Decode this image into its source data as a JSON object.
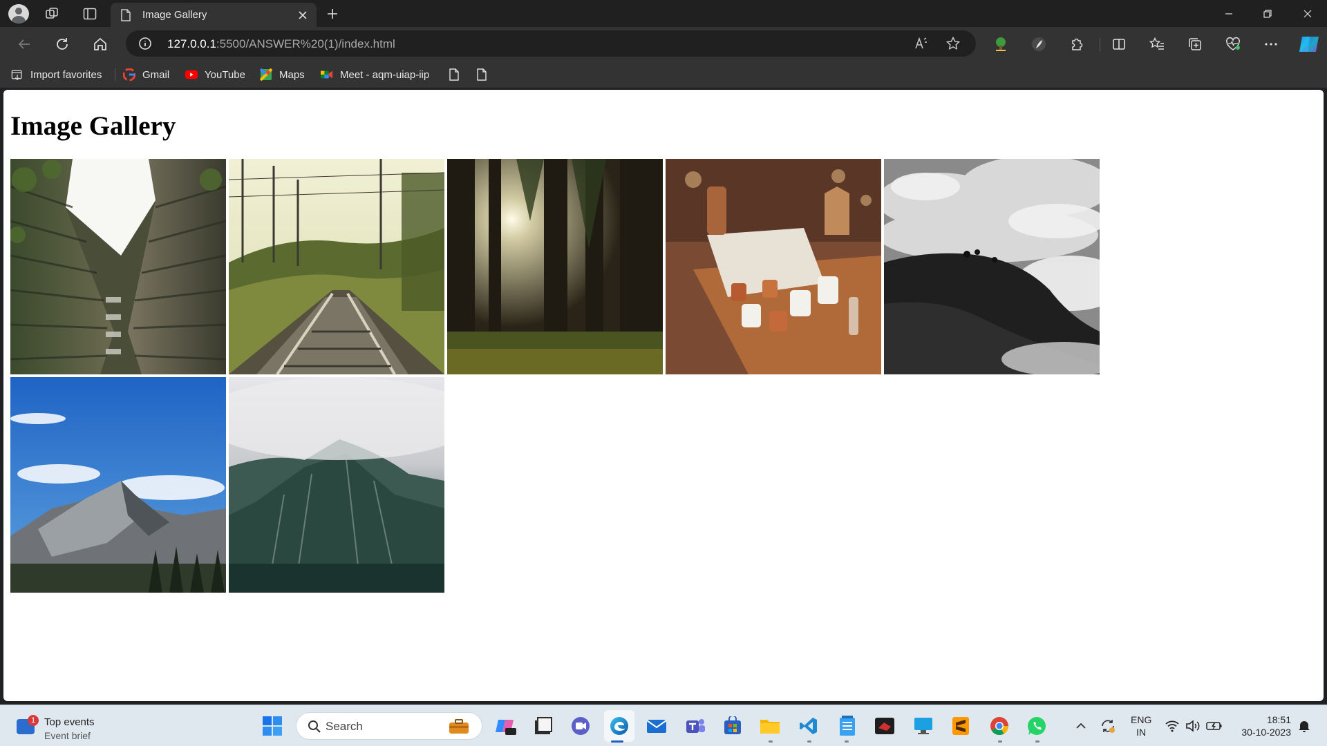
{
  "browser": {
    "tab": {
      "title": "Image Gallery"
    },
    "address": {
      "host": "127.0.0.1",
      "path": ":5500/ANSWER%20(1)/index.html"
    },
    "favorites": [
      {
        "label": "Import favorites",
        "icon": "import-icon"
      },
      {
        "label": "Gmail",
        "icon": "google-icon"
      },
      {
        "label": "YouTube",
        "icon": "youtube-icon"
      },
      {
        "label": "Maps",
        "icon": "maps-icon"
      },
      {
        "label": "Meet - aqm-uiap-iip",
        "icon": "meet-icon"
      }
    ]
  },
  "page": {
    "title": "Image Gallery",
    "images": [
      {
        "subject": "building-courtyard"
      },
      {
        "subject": "railway-track"
      },
      {
        "subject": "sunlit-forest"
      },
      {
        "subject": "cafe-table-cups"
      },
      {
        "subject": "clouds-over-hills"
      },
      {
        "subject": "mountain-blue-sky"
      },
      {
        "subject": "misty-cliff"
      }
    ]
  },
  "taskbar": {
    "widget": {
      "title": "Top events",
      "subtitle": "Event brief",
      "badge": "1"
    },
    "search": {
      "label": "Search"
    },
    "language": {
      "line1": "ENG",
      "line2": "IN"
    },
    "clock": {
      "time": "18:51",
      "date": "30-10-2023"
    }
  },
  "colors": {
    "titlebar": "#202020",
    "toolbar": "#333333",
    "taskbar": "#dfe8ee",
    "accent": "#1f5fbf"
  }
}
